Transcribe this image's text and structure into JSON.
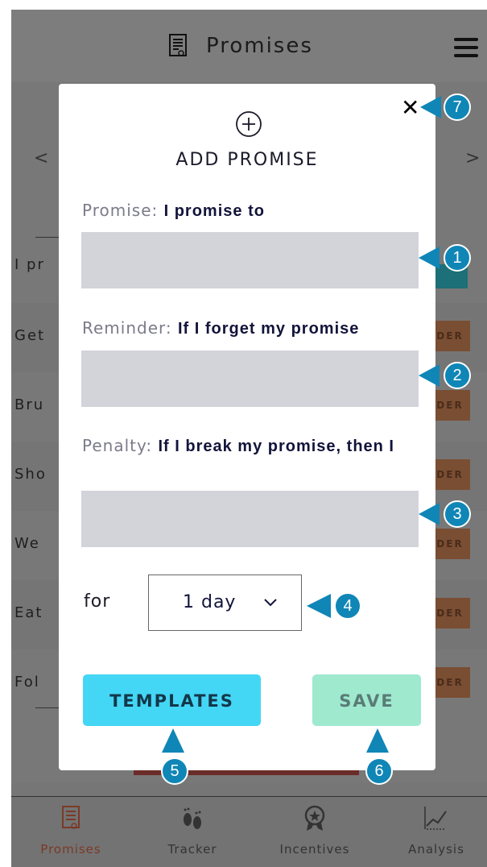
{
  "header": {
    "title": "Promises",
    "menu_icon": "hamburger-icon",
    "doc_icon": "document-icon"
  },
  "background": {
    "rows": [
      {
        "text": "I pr"
      },
      {
        "text": "Get",
        "badge": "DER"
      },
      {
        "text": "Bru",
        "badge": "DER"
      },
      {
        "text": "Sho",
        "badge": "DER"
      },
      {
        "text": "We",
        "badge": "DER"
      },
      {
        "text": "Eat",
        "badge": "DER"
      },
      {
        "text": "Fol",
        "badge": "DER"
      }
    ],
    "prev_arrow": "<",
    "next_arrow": ">"
  },
  "modal": {
    "close": "✕",
    "title": "ADD PROMISE",
    "promise": {
      "label": "Promise:",
      "prompt": "I promise to",
      "value": ""
    },
    "reminder": {
      "label": "Reminder:",
      "prompt": "If I forget my promise",
      "value": ""
    },
    "penalty": {
      "label": "Penalty:",
      "prompt": "If I break my promise, then I",
      "value": ""
    },
    "duration": {
      "label": "for",
      "selected": "1 day"
    },
    "templates_button": "TEMPLATES",
    "save_button": "SAVE"
  },
  "callouts": [
    "1",
    "2",
    "3",
    "4",
    "5",
    "6",
    "7"
  ],
  "bottom_nav": {
    "tabs": [
      {
        "label": "Promises",
        "icon": "document-icon",
        "active": true
      },
      {
        "label": "Tracker",
        "icon": "footprints-icon",
        "active": false
      },
      {
        "label": "Incentives",
        "icon": "award-icon",
        "active": false
      },
      {
        "label": "Analysis",
        "icon": "chart-icon",
        "active": false
      }
    ]
  },
  "colors": {
    "accent_templates": "#44d6f5",
    "accent_save": "#9fe9cf",
    "input_bg": "#d3d4da",
    "callout": "#0f86b6",
    "active_tab": "#7a3a28"
  }
}
